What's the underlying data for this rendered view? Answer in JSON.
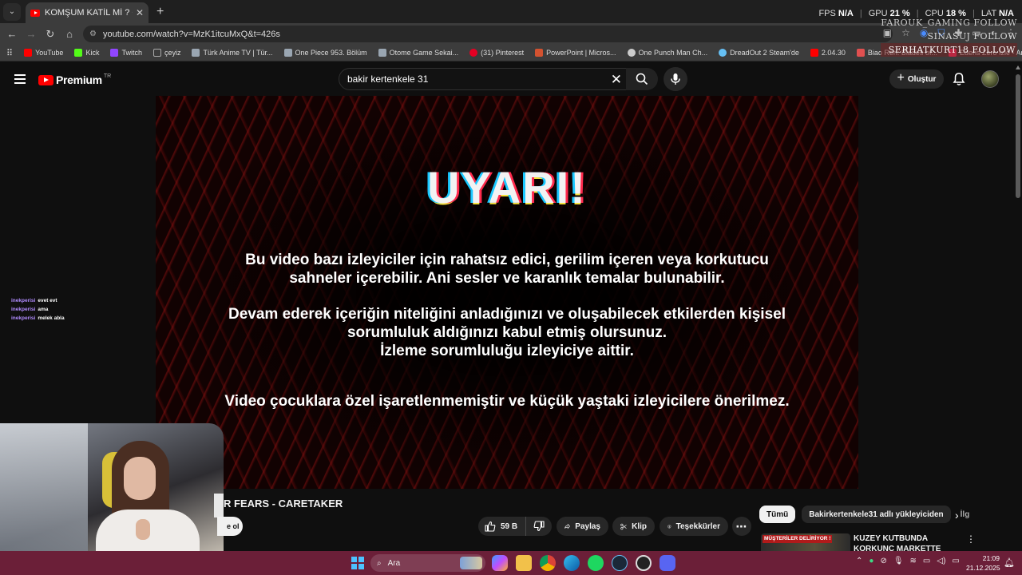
{
  "browser": {
    "tab": {
      "title": "KOMŞUM KATİL Mİ ? OVERCOOKED"
    },
    "address": "youtube.com/watch?v=MzK1itcuMxQ&t=426s",
    "performance": [
      {
        "label": "FPS",
        "value": "N/A"
      },
      {
        "label": "GPU",
        "value": "21 %"
      },
      {
        "label": "CPU",
        "value": "18 %"
      },
      {
        "label": "LAT",
        "value": "N/A"
      }
    ],
    "bookmarks": [
      {
        "label": "YouTube",
        "color": "#ff0000"
      },
      {
        "label": "Kick",
        "color": "#53fc18"
      },
      {
        "label": "Twitch",
        "color": "#9146ff"
      },
      {
        "label": "çeyiz",
        "color": "#aaaaaa"
      },
      {
        "label": "Türk Anime TV | Tür...",
        "color": "#9aa6b2"
      },
      {
        "label": "One Piece 953. Bölüm",
        "color": "#9aa6b2"
      },
      {
        "label": "Otome Game Sekai...",
        "color": "#9aa6b2"
      },
      {
        "label": "(31) Pinterest",
        "color": "#e60023"
      },
      {
        "label": "PowerPoint | Micros...",
        "color": "#d35230"
      },
      {
        "label": "One Punch Man Ch...",
        "color": "#cccccc"
      },
      {
        "label": "DreadOut 2 Steam'de",
        "color": "#66c0f4"
      },
      {
        "label": "2.04.30",
        "color": "#ff0000"
      },
      {
        "label": "Biao Ren: Blades of...",
        "color": "#e05050"
      },
      {
        "label": "Edens Zero İzle - An...",
        "color": "#ff3366"
      }
    ]
  },
  "overlay_names": [
    "FAROUK_GAMING FOLLOW",
    "SINASUJ FOLLOW",
    "SERHATKURT18 FOLLOW"
  ],
  "youtube": {
    "logo_text": "Premium",
    "logo_country": "TR",
    "search_value": "bakir kertenkele 31",
    "create_label": "Oluştur"
  },
  "video": {
    "warning_title": "UYARI!",
    "warning_lines": [
      "Bu video bazı izleyiciler için rahatsız edici, gerilim içeren veya korkutucu",
      "sahneler içerebilir. Ani sesler ve karanlık temalar bulunabilir.",
      "Devam ederek içeriğin niteliğini anladığınızı ve oluşabilecek etkilerden kişisel",
      "sorumluluk aldığınızı kabul etmiş olursunuz.",
      "İzleme sorumluluğu izleyiciye aittir.",
      "Video çocuklara özel işaretlenmemiştir ve küçük yaştaki izleyicilere önerilmez."
    ],
    "title_partial": "R FEARS - CARETAKER",
    "subscribe_partial": "e ol"
  },
  "chat": [
    {
      "user": "inekperisi",
      "message": "evet evt"
    },
    {
      "user": "inekperisi",
      "message": "ama"
    },
    {
      "user": "inekperisi",
      "message": "melek abla"
    }
  ],
  "actions": {
    "likes": "59 B",
    "share": "Paylaş",
    "clip": "Klip",
    "thanks": "Teşekkürler"
  },
  "chips": [
    "Tümü",
    "Bakirkertenkele31 adlı yükleyiciden",
    "İlg"
  ],
  "recommendation": {
    "badge": "MÜŞTERİLER DELİRİYOR !",
    "title": "KUZEY KUTBUNDA KORKUNÇ MARKETTE ÇALIŞMAK !"
  },
  "taskbar": {
    "search_placeholder": "Ara",
    "time": "21:09",
    "date": "21.12.2025"
  }
}
